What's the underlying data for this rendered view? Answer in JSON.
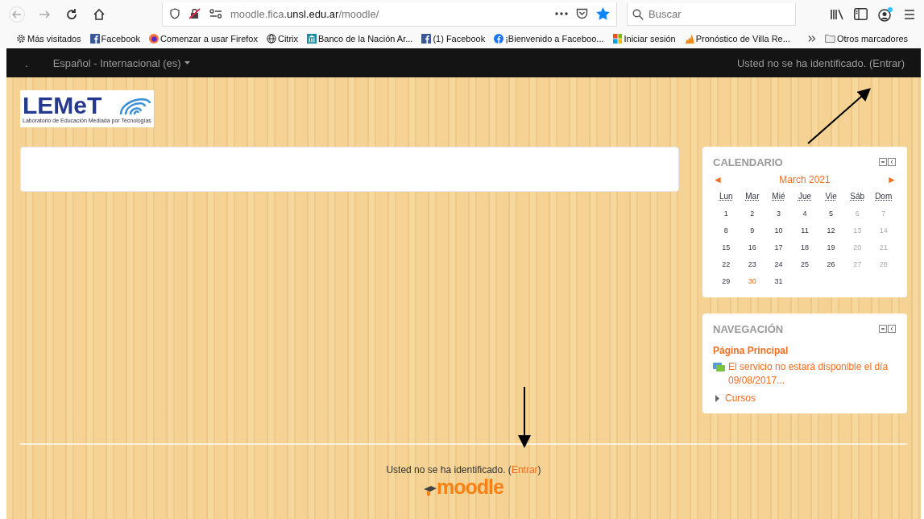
{
  "browser": {
    "url_prefix": "moodle.fica.",
    "url_domain": "unsl.edu.ar",
    "url_suffix": "/moodle/",
    "search_placeholder": "Buscar",
    "bookmarks": [
      {
        "kind": "gear",
        "label": "Más visitados"
      },
      {
        "kind": "facebook",
        "label": "Facebook"
      },
      {
        "kind": "firefox",
        "label": "Comenzar a usar Firefox"
      },
      {
        "kind": "globe",
        "label": "Citrix"
      },
      {
        "kind": "bank",
        "label": "Banco de la Nación Ar..."
      },
      {
        "kind": "facebook",
        "label": "(1) Facebook"
      },
      {
        "kind": "round",
        "label": "¡Bienvenido a Faceboo..."
      },
      {
        "kind": "windows",
        "label": "Iniciar sesión"
      },
      {
        "kind": "flame",
        "label": "Pronóstico de Villa Re..."
      }
    ],
    "other_bookmarks": "Otros marcadores"
  },
  "navbar": {
    "brand": ".",
    "language": "Español - Internacional (es)",
    "login_status": "Usted no se ha identificado. (Entrar)"
  },
  "logo": {
    "title": "LEMeT",
    "subtitle": "Laboratorio de Educación Mediada por Tecnologías"
  },
  "calendar": {
    "title": "CALENDARIO",
    "month": "March 2021",
    "prev": "◄",
    "next": "►",
    "weekdays": [
      "Lun",
      "Mar",
      "Mié",
      "Jue",
      "Vie",
      "Sáb",
      "Dom"
    ],
    "weeks": [
      [
        {
          "d": "1",
          "today": false
        },
        {
          "d": "2",
          "today": false
        },
        {
          "d": "3",
          "today": false
        },
        {
          "d": "4",
          "today": false
        },
        {
          "d": "5",
          "today": false
        },
        {
          "d": "6",
          "today": false
        },
        {
          "d": "7",
          "today": false
        }
      ],
      [
        {
          "d": "8",
          "today": false
        },
        {
          "d": "9",
          "today": false
        },
        {
          "d": "10",
          "today": false
        },
        {
          "d": "11",
          "today": false
        },
        {
          "d": "12",
          "today": false
        },
        {
          "d": "13",
          "today": false
        },
        {
          "d": "14",
          "today": false
        }
      ],
      [
        {
          "d": "15",
          "today": false
        },
        {
          "d": "16",
          "today": false
        },
        {
          "d": "17",
          "today": false
        },
        {
          "d": "18",
          "today": false
        },
        {
          "d": "19",
          "today": false
        },
        {
          "d": "20",
          "today": false
        },
        {
          "d": "21",
          "today": false
        }
      ],
      [
        {
          "d": "22",
          "today": false
        },
        {
          "d": "23",
          "today": false
        },
        {
          "d": "24",
          "today": false
        },
        {
          "d": "25",
          "today": false
        },
        {
          "d": "26",
          "today": false
        },
        {
          "d": "27",
          "today": false
        },
        {
          "d": "28",
          "today": false
        }
      ],
      [
        {
          "d": "29",
          "today": false
        },
        {
          "d": "30",
          "today": true
        },
        {
          "d": "31",
          "today": false
        }
      ]
    ]
  },
  "navigation": {
    "title": "NAVEGACIÓN",
    "home": "Página Principal",
    "news": "El servicio no estará disponible el día 09/08/2017...",
    "courses": "Cursos",
    "courses_expanded": false
  },
  "footer": {
    "before": "Usted no se ha identificado. (",
    "link": "Entrar",
    "after": ")",
    "logo": "moodle"
  }
}
